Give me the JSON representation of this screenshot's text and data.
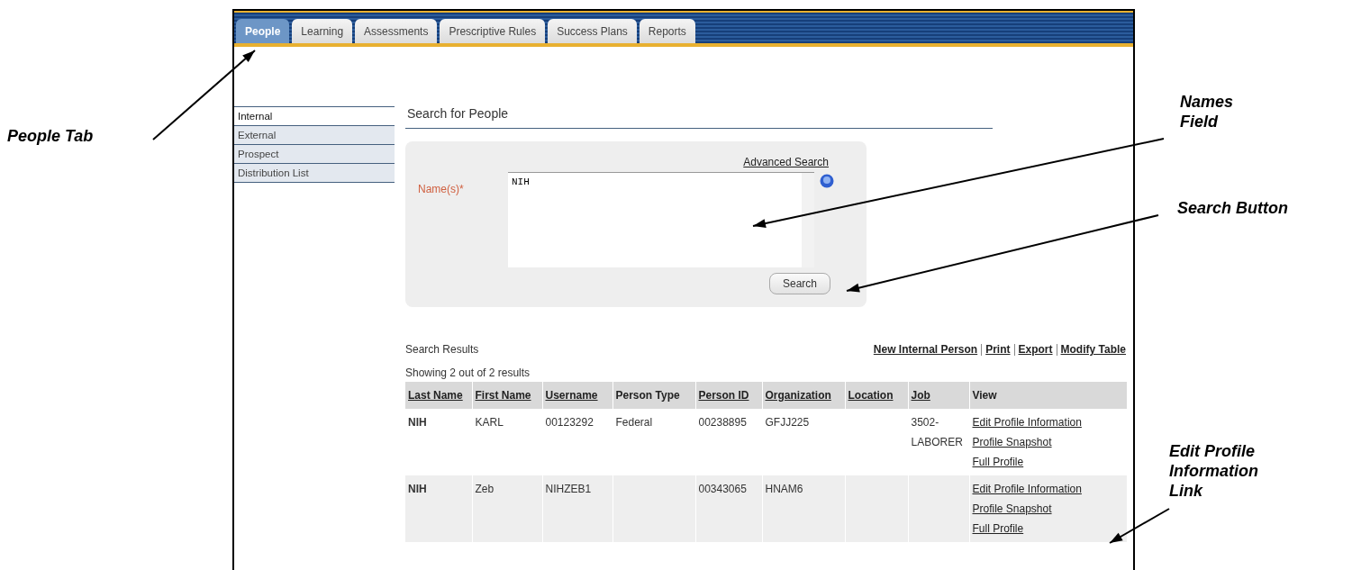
{
  "tabs": [
    {
      "label": "People",
      "selected": true
    },
    {
      "label": "Learning",
      "selected": false
    },
    {
      "label": "Assessments",
      "selected": false
    },
    {
      "label": "Prescriptive Rules",
      "selected": false
    },
    {
      "label": "Success Plans",
      "selected": false
    },
    {
      "label": "Reports",
      "selected": false
    }
  ],
  "sidebar": {
    "items": [
      {
        "label": "Internal",
        "selected": true
      },
      {
        "label": "External",
        "selected": false
      },
      {
        "label": "Prospect",
        "selected": false
      },
      {
        "label": "Distribution List",
        "selected": false
      }
    ]
  },
  "page_title": "Search for People",
  "search": {
    "advanced_link": "Advanced Search",
    "label": "Name(s)*",
    "value": "NIH",
    "button": "Search"
  },
  "results": {
    "title": "Search Results",
    "actions": [
      "New Internal Person",
      "Print",
      "Export",
      "Modify Table"
    ],
    "count": "Showing 2 out of 2 results"
  },
  "table": {
    "columns": [
      {
        "label": "Last Name",
        "sortable": true
      },
      {
        "label": "First Name",
        "sortable": true
      },
      {
        "label": "Username",
        "sortable": true
      },
      {
        "label": "Person Type",
        "sortable": false
      },
      {
        "label": "Person ID",
        "sortable": true
      },
      {
        "label": "Organization",
        "sortable": true
      },
      {
        "label": "Location",
        "sortable": true
      },
      {
        "label": "Job",
        "sortable": true
      },
      {
        "label": "View",
        "sortable": false
      }
    ],
    "rows": [
      {
        "cells": [
          "NIH",
          "KARL",
          "00123292",
          "Federal",
          "00238895",
          "GFJJ225",
          "",
          "3502-LABORER"
        ],
        "links": [
          "Edit Profile Information",
          "Profile Snapshot",
          "Full Profile"
        ]
      },
      {
        "cells": [
          "NIH",
          "Zeb",
          "NIHZEB1",
          "",
          "00343065",
          "HNAM6",
          "",
          ""
        ],
        "links": [
          "Edit Profile Information",
          "Profile Snapshot",
          "Full Profile"
        ]
      }
    ]
  },
  "callouts": [
    {
      "text": "People Tab"
    },
    {
      "text": "Names Field"
    },
    {
      "text": "Search Button"
    },
    {
      "text": "Edit Profile Information Link"
    }
  ]
}
